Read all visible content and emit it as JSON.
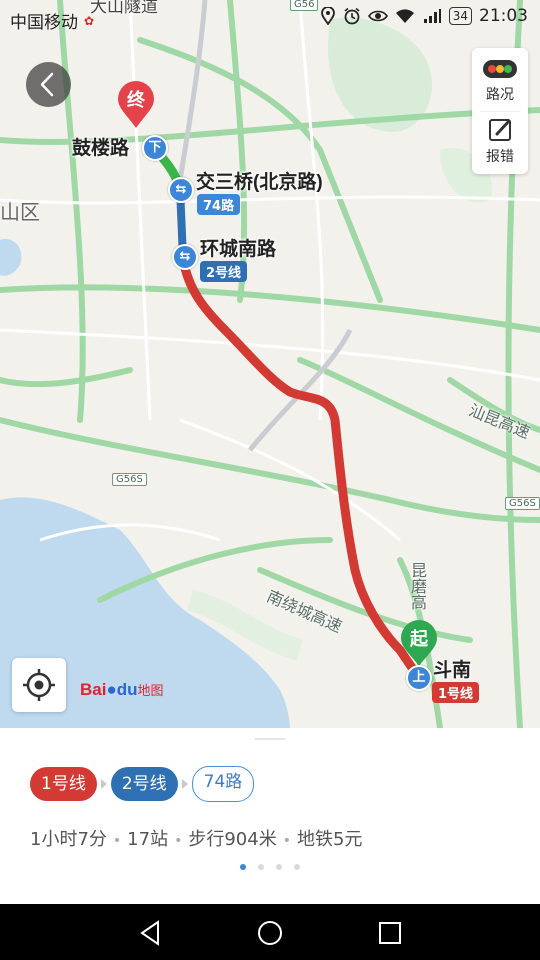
{
  "status_bar": {
    "carrier": "中国移动",
    "battery": "34",
    "time": "21:03"
  },
  "map": {
    "terminal_marker": "终",
    "start_marker": "起",
    "alight_marker": "下",
    "board_marker": "上",
    "places": {
      "destination": "鼓楼路",
      "transfer1": "交三桥(北京路)",
      "transfer2": "环城南路",
      "origin": "斗南",
      "district": "山区",
      "top_partial": "大山隧道"
    },
    "route_tags": {
      "bus": "74路",
      "line2": "2号线",
      "line1": "1号线"
    },
    "roads": {
      "shankun": "汕昆高速",
      "nanrao": "南绕城高速",
      "kunmo": "昆磨高"
    },
    "highway_badges": [
      "G56S",
      "G56S",
      "G56"
    ],
    "controls": {
      "traffic_label": "路况",
      "report_label": "报错"
    },
    "logo_text": "Bai",
    "logo_tail": "du",
    "logo_cn": "地图",
    "route_colors": {
      "line1": "#d33a33",
      "line2": "#2f6fb3",
      "bus": "#3bb54a"
    }
  },
  "route_summary": {
    "segments": [
      "1号线",
      "2号线",
      "74路"
    ],
    "duration": "1小时7分",
    "stops": "17站",
    "walk": "步行904米",
    "fare": "地铁5元",
    "page_count": 4,
    "active_page": 1
  }
}
